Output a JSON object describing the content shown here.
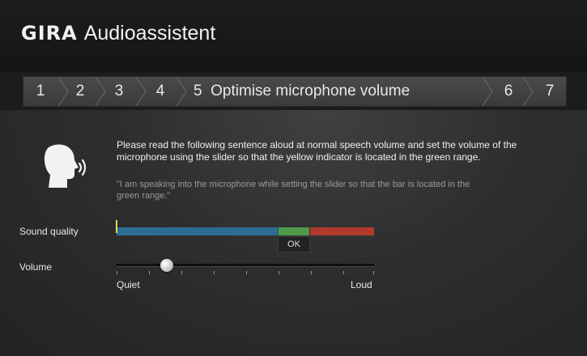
{
  "app": {
    "logo": "GIRA",
    "title": "Audioassistent"
  },
  "steps": [
    {
      "number": "1"
    },
    {
      "number": "2"
    },
    {
      "number": "3"
    },
    {
      "number": "4"
    },
    {
      "number": "5",
      "label": "Optimise microphone volume",
      "active": true
    },
    {
      "number": "6"
    },
    {
      "number": "7"
    }
  ],
  "instructions": {
    "text": "Please read the following sentence aloud at normal speech volume and set the volume of the microphone using the slider so that the yellow indicator is located in the green range.",
    "quote": "\"I am speaking into the microphone while setting the slider so that the bar is located in the green range.\""
  },
  "sound_quality": {
    "label": "Sound quality",
    "ok_label": "OK",
    "level": 0.0,
    "colors": {
      "low": "#2b6d95",
      "ok": "#4f9a4a",
      "high": "#b23a2c",
      "indicator": "#e5d84a"
    }
  },
  "volume": {
    "label": "Volume",
    "min_label": "Quiet",
    "max_label": "Loud",
    "value": 0.2
  },
  "icons": {
    "speaker": "speaking-head-icon"
  }
}
